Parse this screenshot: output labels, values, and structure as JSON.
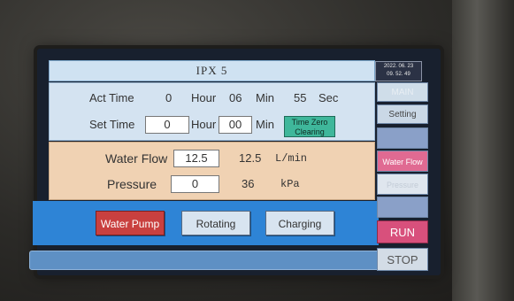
{
  "title": "IPX 5",
  "datetime": {
    "date": "2022. 06. 23",
    "time": "09. 52. 49"
  },
  "time_panel": {
    "act_label": "Act Time",
    "act_hour_value": "0",
    "hour_label": "Hour",
    "act_min_value": "06",
    "min_label": "Min",
    "act_sec_value": "55",
    "sec_label": "Sec",
    "set_label": "Set Time",
    "set_hour_value": "0",
    "set_hour_label": "Hour",
    "set_min_value": "00",
    "set_min_label": "Min",
    "clear_button": "Time Zero Clearing"
  },
  "flow_panel": {
    "water_flow_label": "Water Flow",
    "water_flow_set": "12.5",
    "water_flow_actual": "12.5",
    "water_flow_unit": "L/min",
    "pressure_label": "Pressure",
    "pressure_set": "0",
    "pressure_actual": "36",
    "pressure_unit": "kPa"
  },
  "actions": {
    "water_pump": "Water Pump",
    "rotating": "Rotating",
    "charging": "Charging"
  },
  "side_menu": {
    "main": "MAIN",
    "setting": "Setting",
    "water_flow": "Water Flow",
    "pressure": "Pressure",
    "run": "RUN",
    "stop": "STOP"
  },
  "colors": {
    "water_pump_active": "#c9403f",
    "tzc_button": "#3fb79b",
    "run_button": "#d8507c",
    "panel_time": "#d4e3f1",
    "panel_flow": "#f0d2b3",
    "panel_buttons": "#2e84d6"
  }
}
